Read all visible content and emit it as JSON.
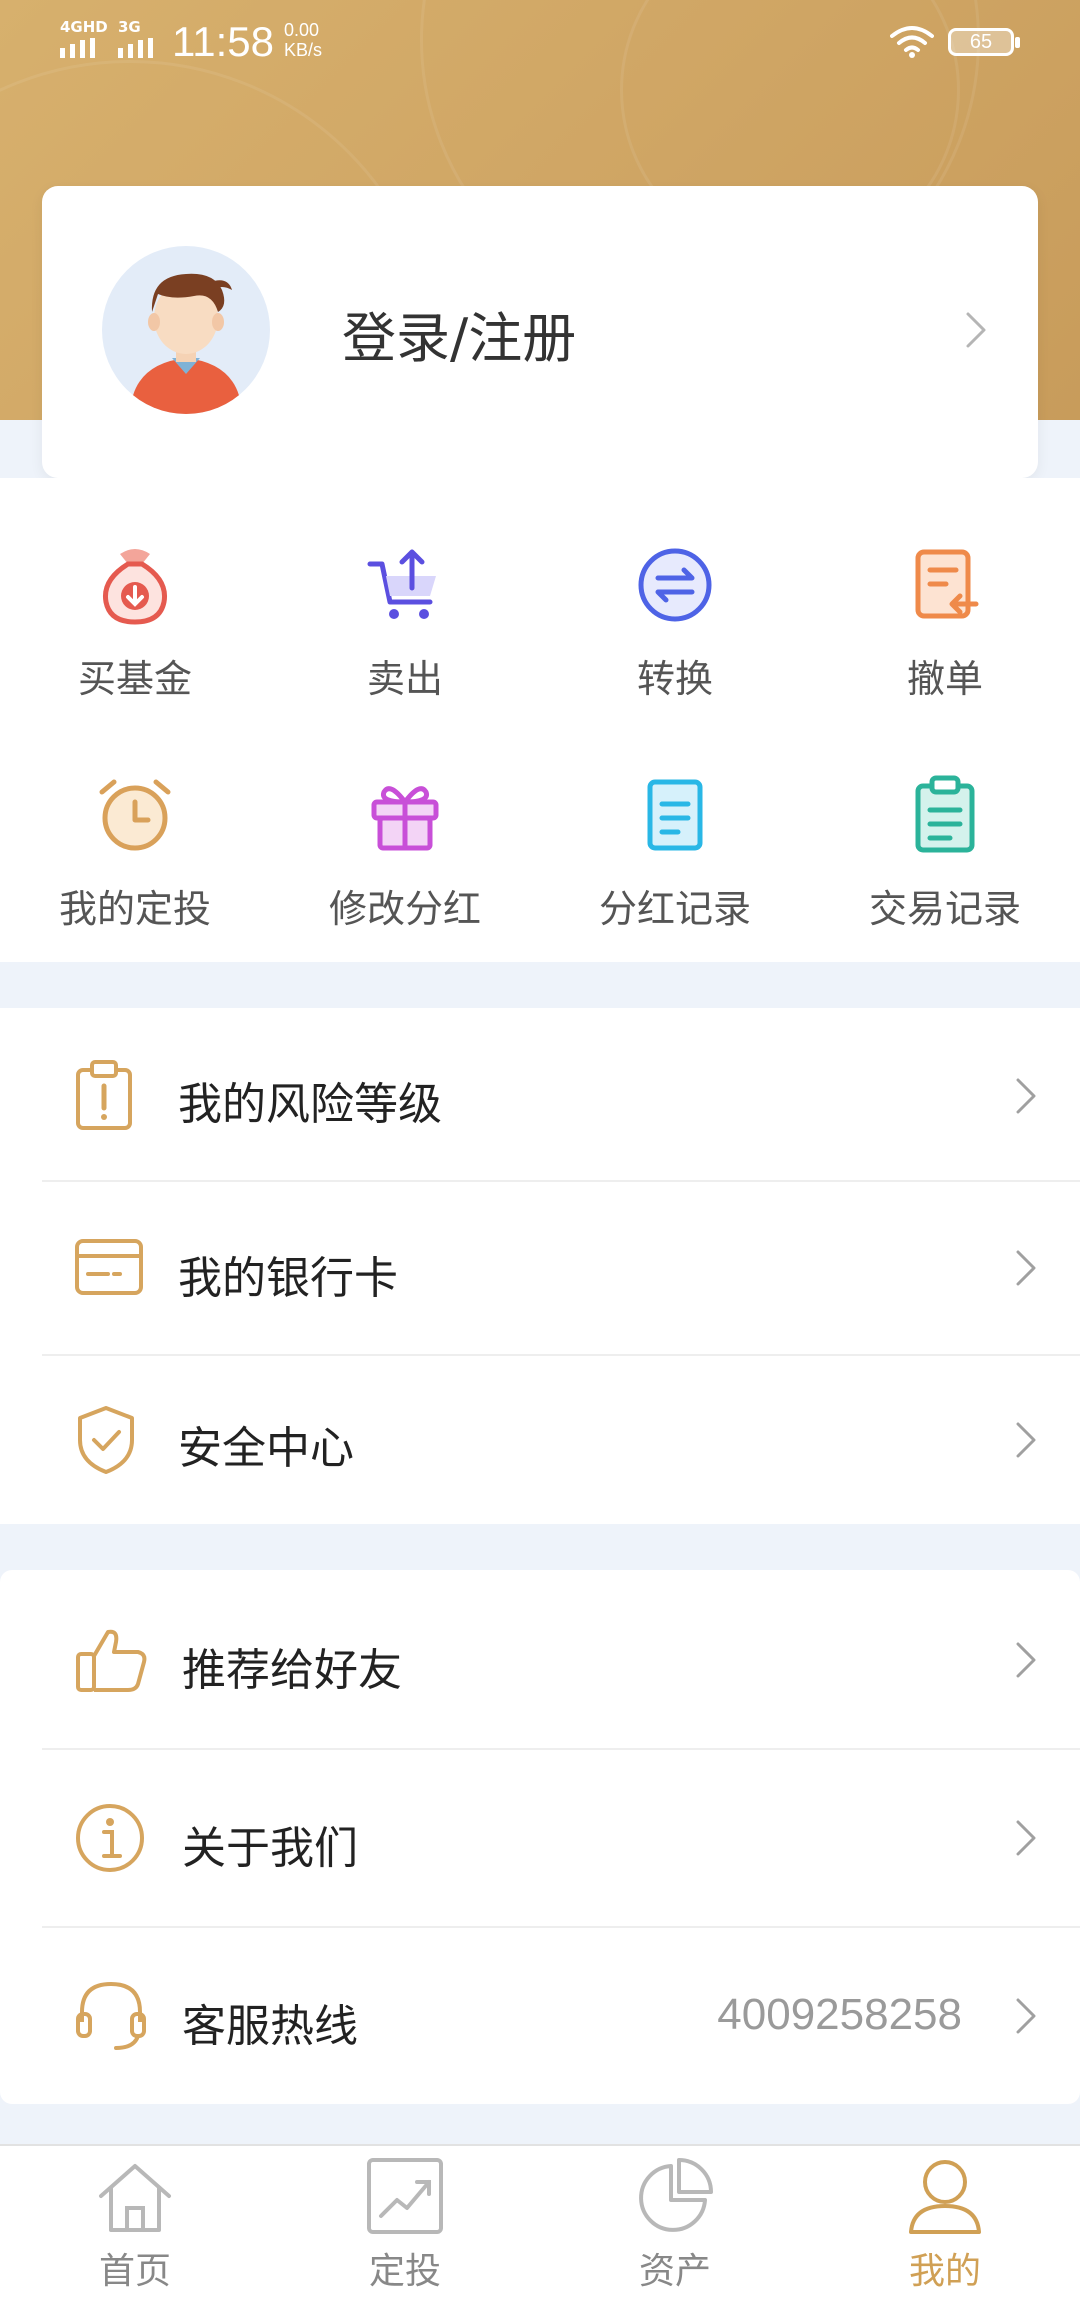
{
  "status_bar": {
    "network1": "4GHD",
    "network2": "3G",
    "time": "11:58",
    "speed_value": "0.00",
    "speed_unit": "KB/s",
    "battery": "65"
  },
  "profile": {
    "login_label": "登录/注册"
  },
  "quick_actions": [
    {
      "label": "买基金",
      "icon": "money-bag-download-icon",
      "color": "#e55a4f"
    },
    {
      "label": "卖出",
      "icon": "cart-upload-icon",
      "color": "#5b4fe0"
    },
    {
      "label": "转换",
      "icon": "exchange-circle-icon",
      "color": "#4e63e6"
    },
    {
      "label": "撤单",
      "icon": "document-return-icon",
      "color": "#ef8a4a"
    },
    {
      "label": "我的定投",
      "icon": "alarm-clock-icon",
      "color": "#d9a15a"
    },
    {
      "label": "修改分红",
      "icon": "gift-icon",
      "color": "#c84fd8"
    },
    {
      "label": "分红记录",
      "icon": "notepad-icon",
      "color": "#29b7e6"
    },
    {
      "label": "交易记录",
      "icon": "clipboard-icon",
      "color": "#2bb39a"
    }
  ],
  "menu_section1": [
    {
      "label": "我的风险等级",
      "icon": "risk-clipboard-icon"
    },
    {
      "label": "我的银行卡",
      "icon": "bank-card-icon"
    },
    {
      "label": "安全中心",
      "icon": "shield-check-icon"
    }
  ],
  "menu_section2": [
    {
      "label": "推荐给好友",
      "icon": "thumbs-up-icon"
    },
    {
      "label": "关于我们",
      "icon": "info-icon"
    },
    {
      "label": "客服热线",
      "icon": "headset-icon",
      "value": "4009258258"
    }
  ],
  "tabs": [
    {
      "label": "首页",
      "icon": "home-icon",
      "active": false
    },
    {
      "label": "定投",
      "icon": "chart-trend-icon",
      "active": false
    },
    {
      "label": "资产",
      "icon": "pie-chart-icon",
      "active": false
    },
    {
      "label": "我的",
      "icon": "user-icon",
      "active": true
    }
  ],
  "colors": {
    "accent": "#d0a055",
    "header": "#cfa564",
    "icon_gold": "#d6a55e"
  }
}
